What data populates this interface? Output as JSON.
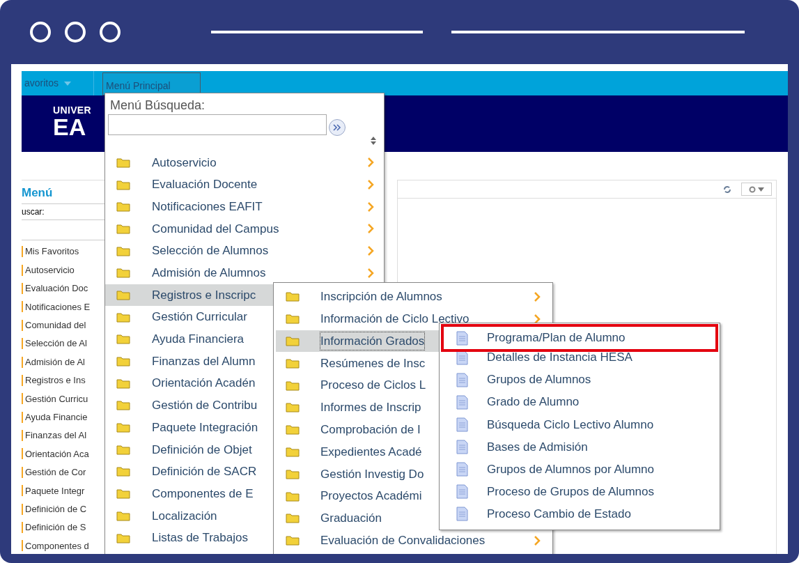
{
  "nav": {
    "tabs": [
      {
        "label": "avoritos",
        "selected": false,
        "has_dropdown": true
      },
      {
        "label": "Menú Principal",
        "selected": true,
        "has_dropdown": false
      }
    ]
  },
  "logo": {
    "line_1": "UNIVER",
    "line_2": "EA"
  },
  "sidebar": {
    "title": "Menú",
    "search_label": "uscar:",
    "items": [
      "Mis Favoritos",
      "Autoservicio",
      "Evaluación Doc",
      "Notificaciones E",
      "Comunidad del",
      "Selección de Al",
      "Admisión de Al",
      "Registros e Ins",
      "Gestión Curricu",
      "Ayuda Financie",
      "Finanzas del Al",
      "Orientación Aca",
      "Gestión de Cor",
      "Paquete Integr",
      "Definición de C",
      "Definición de S",
      "Componentes d"
    ]
  },
  "main_menu": {
    "search_label": "Menú Búsqueda:",
    "items": [
      {
        "label": "Autoservicio",
        "selected": false,
        "has_submenu": true
      },
      {
        "label": "Evaluación Docente",
        "selected": false,
        "has_submenu": true
      },
      {
        "label": "Notificaciones EAFIT",
        "selected": false,
        "has_submenu": true
      },
      {
        "label": "Comunidad del Campus",
        "selected": false,
        "has_submenu": true
      },
      {
        "label": "Selección de Alumnos",
        "selected": false,
        "has_submenu": true
      },
      {
        "label": "Admisión de Alumnos",
        "selected": false,
        "has_submenu": true
      },
      {
        "label": "Registros e Inscripc",
        "selected": true,
        "has_submenu": false
      },
      {
        "label": "Gestión Curricular",
        "selected": false,
        "has_submenu": false
      },
      {
        "label": "Ayuda Financiera",
        "selected": false,
        "has_submenu": false
      },
      {
        "label": "Finanzas del Alumn",
        "selected": false,
        "has_submenu": false
      },
      {
        "label": "Orientación Acadén",
        "selected": false,
        "has_submenu": false
      },
      {
        "label": "Gestión de Contribu",
        "selected": false,
        "has_submenu": false
      },
      {
        "label": "Paquete Integración",
        "selected": false,
        "has_submenu": false
      },
      {
        "label": "Definición de Objet",
        "selected": false,
        "has_submenu": false
      },
      {
        "label": "Definición de SACR",
        "selected": false,
        "has_submenu": false
      },
      {
        "label": "Componentes de E",
        "selected": false,
        "has_submenu": false
      },
      {
        "label": "Localización",
        "selected": false,
        "has_submenu": false
      },
      {
        "label": "Listas de Trabajos",
        "selected": false,
        "has_submenu": false
      }
    ]
  },
  "submenu": {
    "items": [
      {
        "label": "Inscripción de Alumnos",
        "selected": false,
        "has_submenu": true
      },
      {
        "label": "Información de Ciclo Lectivo",
        "selected": false,
        "has_submenu": true
      },
      {
        "label": "Información Grados",
        "selected": true,
        "has_submenu": false
      },
      {
        "label": "Resúmenes de Insc",
        "selected": false,
        "has_submenu": false
      },
      {
        "label": "Proceso de Ciclos L",
        "selected": false,
        "has_submenu": false
      },
      {
        "label": "Informes de Inscrip",
        "selected": false,
        "has_submenu": false
      },
      {
        "label": "Comprobación de I",
        "selected": false,
        "has_submenu": false
      },
      {
        "label": "Expedientes Acadé",
        "selected": false,
        "has_submenu": false
      },
      {
        "label": "Gestión Investig Do",
        "selected": false,
        "has_submenu": false
      },
      {
        "label": "Proyectos Académi",
        "selected": false,
        "has_submenu": false
      },
      {
        "label": "Graduación",
        "selected": false,
        "has_submenu": false
      },
      {
        "label": "Evaluación de Convalidaciones",
        "selected": false,
        "has_submenu": true
      }
    ]
  },
  "page_menu": {
    "items": [
      {
        "label": "Programa/Plan de Alumno",
        "highlighted": true
      },
      {
        "label": "Detalles de Instancia HESA",
        "highlighted": false
      },
      {
        "label": "Grupos de Alumnos",
        "highlighted": false
      },
      {
        "label": "Grado de Alumno",
        "highlighted": false
      },
      {
        "label": "Búsqueda Ciclo Lectivo Alumno",
        "highlighted": false
      },
      {
        "label": "Bases de Admisión",
        "highlighted": false
      },
      {
        "label": "Grupos de Alumnos por Alumno",
        "highlighted": false
      },
      {
        "label": "Proceso de Grupos de Alumnos",
        "highlighted": false
      },
      {
        "label": "Proceso Cambio de Estado",
        "highlighted": false
      }
    ]
  }
}
